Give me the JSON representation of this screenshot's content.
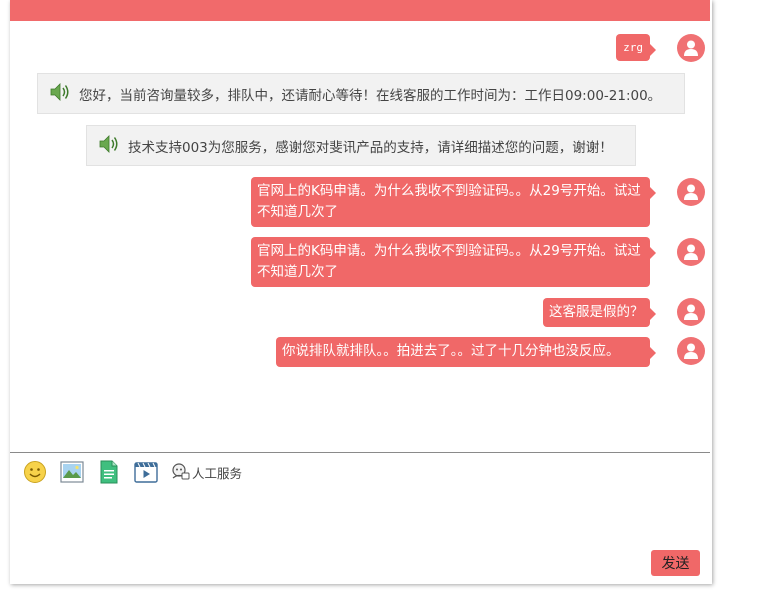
{
  "colors": {
    "accent": "#f06868",
    "topbar": "#f16a6b",
    "system_bg": "#f2f2f2"
  },
  "user": {
    "avatar_icon": "user-icon"
  },
  "messages": [
    {
      "type": "user",
      "text": "zrg"
    },
    {
      "type": "system",
      "text": "您好，当前咨询量较多，排队中，还请耐心等待！在线客服的工作时间为：工作日09:00-21:00。"
    },
    {
      "type": "system",
      "text": "技术支持003为您服务，感谢您对斐讯产品的支持，请详细描述您的问题，谢谢！"
    },
    {
      "type": "user",
      "text": "官网上的K码申请。为什么我收不到验证码。。从29号开始。试过不知道几次了"
    },
    {
      "type": "user",
      "text": "官网上的K码申请。为什么我收不到验证码。。从29号开始。试过不知道几次了"
    },
    {
      "type": "user",
      "text": "这客服是假的？"
    },
    {
      "type": "user",
      "text": "你说排队就排队。。拍进去了。。过了十几分钟也没反应。"
    }
  ],
  "toolbar": {
    "emoji_icon": "smiley-icon",
    "image_icon": "image-icon",
    "file_icon": "document-icon",
    "video_icon": "video-icon",
    "manual_label": "人工服务"
  },
  "send_label": "发送"
}
